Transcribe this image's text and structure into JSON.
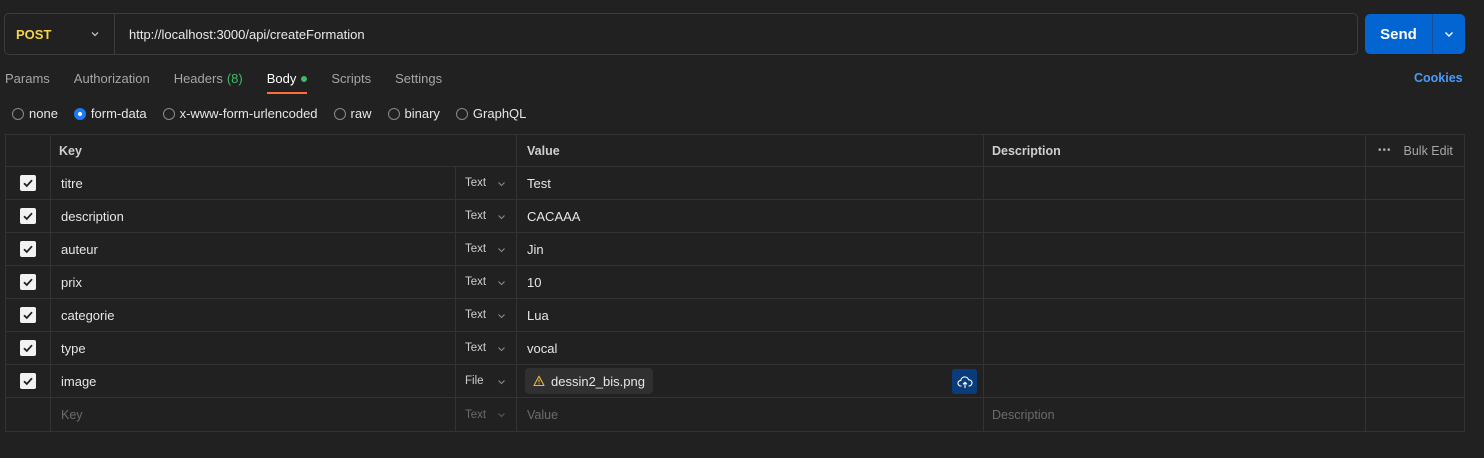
{
  "request": {
    "method": "POST",
    "url": "http://localhost:3000/api/createFormation",
    "send_label": "Send"
  },
  "tabs": [
    {
      "label": "Params"
    },
    {
      "label": "Authorization"
    },
    {
      "label": "Headers",
      "count": "(8)"
    },
    {
      "label": "Body",
      "active": true
    },
    {
      "label": "Scripts"
    },
    {
      "label": "Settings"
    }
  ],
  "cookies_label": "Cookies",
  "body_types": [
    {
      "label": "none"
    },
    {
      "label": "form-data",
      "selected": true
    },
    {
      "label": "x-www-form-urlencoded"
    },
    {
      "label": "raw"
    },
    {
      "label": "binary"
    },
    {
      "label": "GraphQL"
    }
  ],
  "table": {
    "headers": {
      "key": "Key",
      "value": "Value",
      "description": "Description",
      "bulk_edit": "Bulk Edit"
    },
    "rows": [
      {
        "key": "titre",
        "type": "Text",
        "value": "Test"
      },
      {
        "key": "description",
        "type": "Text",
        "value": "CACAAA"
      },
      {
        "key": "auteur",
        "type": "Text",
        "value": "Jin"
      },
      {
        "key": "prix",
        "type": "Text",
        "value": "10"
      },
      {
        "key": "categorie",
        "type": "Text",
        "value": "Lua"
      },
      {
        "key": "type",
        "type": "Text",
        "value": "vocal"
      },
      {
        "key": "image",
        "type": "File",
        "value": "dessin2_bis.png"
      }
    ],
    "placeholder": {
      "key": "Key",
      "type": "Text",
      "value": "Value",
      "description": "Description"
    }
  },
  "colors": {
    "accent": "#ff6c37",
    "send": "#0265d2",
    "method": "#f5d44a",
    "link": "#4a9bf7",
    "success": "#3fb968"
  }
}
